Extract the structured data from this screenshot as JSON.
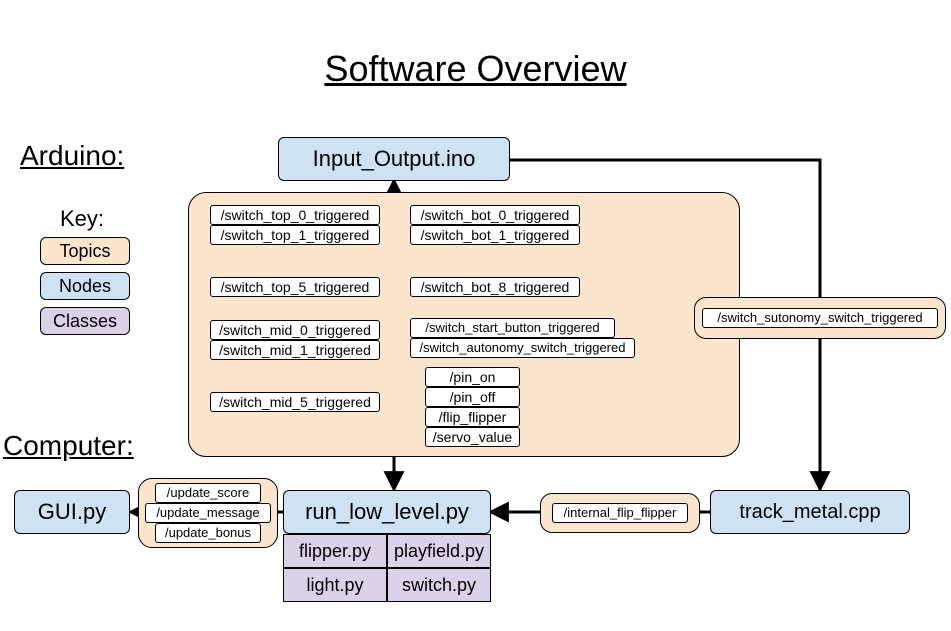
{
  "title": "Software Overview",
  "sections": {
    "arduino": "Arduino:",
    "computer": "Computer:"
  },
  "key": {
    "heading": "Key:",
    "topics": "Topics",
    "nodes": "Nodes",
    "classes": "Classes"
  },
  "nodes": {
    "input_output": "Input_Output.ino",
    "gui": "GUI.py",
    "run_low": "run_low_level.py",
    "track_metal": "track_metal.cpp"
  },
  "classes": {
    "flipper": "flipper.py",
    "playfield": "playfield.py",
    "light": "light.py",
    "switch": "switch.py"
  },
  "topic_clouds": {
    "main": {
      "switch_top": [
        "/switch_top_0_triggered",
        "/switch_top_1_triggered",
        "/switch_top_5_triggered"
      ],
      "switch_mid": [
        "/switch_mid_0_triggered",
        "/switch_mid_1_triggered",
        "/switch_mid_5_triggered"
      ],
      "switch_bot": [
        "/switch_bot_0_triggered",
        "/switch_bot_1_triggered",
        "/switch_bot_8_triggered"
      ],
      "misc": [
        "/switch_start_button_triggered",
        "/switch_autonomy_switch_triggered"
      ],
      "outputs": [
        "/pin_on",
        "/pin_off",
        "/flip_flipper",
        "/servo_value"
      ]
    },
    "right": {
      "autonomy": "/switch_sutonomy_switch_triggered"
    },
    "gui_updates": [
      "/update_score",
      "/update_message",
      "/update_bonus"
    ],
    "internal": "/internal_flip_flipper"
  }
}
